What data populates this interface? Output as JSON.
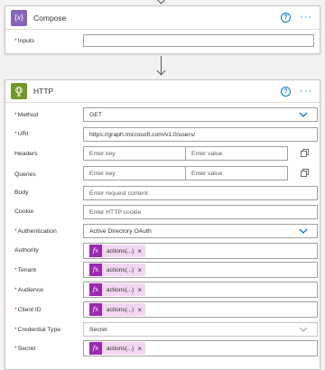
{
  "compose": {
    "title": "Compose",
    "icon": "code-braces-icon",
    "color": "#8764b8",
    "inputs_label": "Inputs",
    "inputs_value": ""
  },
  "http": {
    "title": "HTTP",
    "icon": "globe-icon",
    "color": "#709727",
    "method_label": "Method",
    "method_value": "GET",
    "uri_label": "URI",
    "uri_value": "https://graph.microsoft.com/v1.0/users/",
    "headers_label": "Headers",
    "headers_key_ph": "Enter key",
    "headers_val_ph": "Enter value",
    "queries_label": "Queries",
    "queries_key_ph": "Enter key",
    "queries_val_ph": "Enter value",
    "body_label": "Body",
    "body_ph": "Enter request content",
    "cookie_label": "Cookie",
    "cookie_ph": "Enter HTTP cookie",
    "auth_label": "Authentication",
    "auth_value": "Active Directory OAuth",
    "authority_label": "Authority",
    "tenant_label": "Tenant",
    "audience_label": "Audience",
    "clientid_label": "Client ID",
    "credtype_label": "Credential Type",
    "credtype_value": "Secret",
    "secret_label": "Secret",
    "token_text": "actions(...)",
    "token_remove": "×",
    "token_fx": "fx"
  },
  "header_actions": {
    "help": "?",
    "more": "···"
  }
}
